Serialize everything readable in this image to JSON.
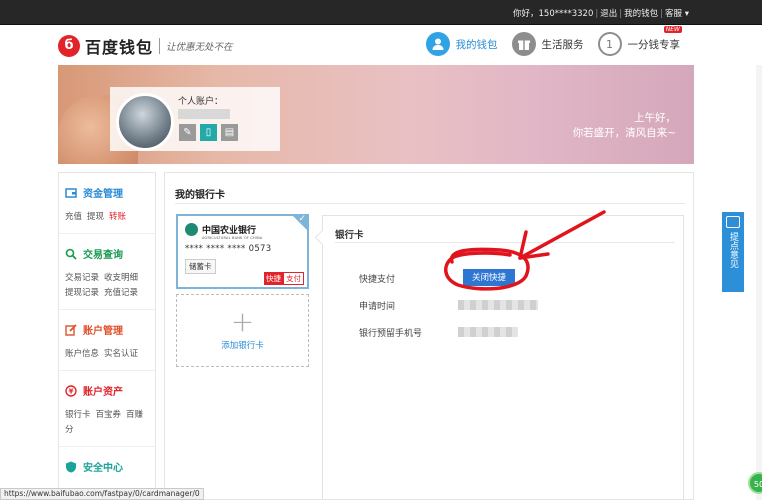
{
  "topbar": {
    "greeting": "你好，150****3320",
    "logout": "退出",
    "my_wallet": "我的钱包",
    "service": "客服 ▾"
  },
  "header": {
    "logo_mark": "б",
    "logo_text": "百度钱包",
    "slogan": "让优惠无处不在",
    "nav": [
      {
        "label": "我的钱包",
        "icon": "person-icon"
      },
      {
        "label": "生活服务",
        "icon": "gift-icon"
      },
      {
        "label": "一分钱专享",
        "icon": "coin-icon",
        "badge": "NEW",
        "glyph": "1"
      }
    ]
  },
  "banner": {
    "account_label": "个人账户：",
    "greeting_line1": "上午好，",
    "greeting_line2": "你若盛开，清风自来~"
  },
  "sidebar": {
    "sections": [
      {
        "title": "资金管理",
        "color": "#2a8bd6",
        "icon": "wallet-icon",
        "links": [
          "充值",
          "提现",
          "转账"
        ]
      },
      {
        "title": "交易查询",
        "color": "#1a9a52",
        "icon": "search-icon",
        "links": [
          "交易记录",
          "收支明细",
          "提现记录",
          "充值记录"
        ]
      },
      {
        "title": "账户管理",
        "color": "#e0502a",
        "icon": "edit-icon",
        "links": [
          "账户信息",
          "实名认证"
        ]
      },
      {
        "title": "账户资产",
        "color": "#e2232a",
        "icon": "yen-icon",
        "links": [
          "银行卡",
          "百宝券",
          "百赚分"
        ]
      },
      {
        "title": "安全中心",
        "color": "#1aa39a",
        "icon": "shield-icon",
        "links": []
      }
    ]
  },
  "main": {
    "title": "我的银行卡",
    "card": {
      "bank_name": "中国农业银行",
      "bank_en": "AGRICULTURAL BANK OF CHINA",
      "number": "**** **** **** 0573",
      "type": "储蓄卡",
      "quick_a": "快捷",
      "quick_b": "支付"
    },
    "add_card": {
      "plus": "+",
      "label": "添加银行卡"
    },
    "detail": {
      "title": "银行卡",
      "quick_pay_label": "快捷支付",
      "close_button": "关闭快捷",
      "apply_time_label": "申请时间",
      "phone_label": "银行预留手机号"
    }
  },
  "feedback": {
    "label": "提点意见"
  },
  "statusbar": {
    "url": "https://www.baifubao.com/fastpay/0/cardmanager/0"
  },
  "corner_ball": "50"
}
